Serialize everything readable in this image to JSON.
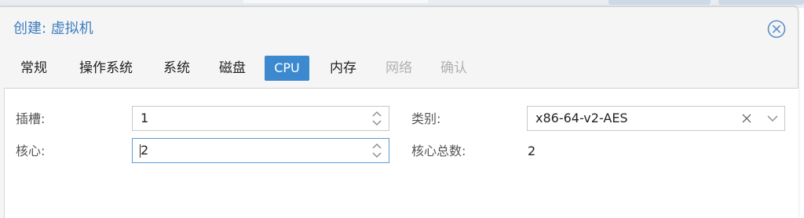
{
  "dialog": {
    "title": "创建: 虚拟机",
    "close_icon": "close-circle-icon"
  },
  "tabs": [
    {
      "label": "常规",
      "state": "normal"
    },
    {
      "label": "操作系统",
      "state": "normal"
    },
    {
      "label": "系统",
      "state": "normal"
    },
    {
      "label": "磁盘",
      "state": "normal"
    },
    {
      "label": "CPU",
      "state": "active"
    },
    {
      "label": "内存",
      "state": "normal"
    },
    {
      "label": "网络",
      "state": "disabled"
    },
    {
      "label": "确认",
      "state": "disabled"
    }
  ],
  "cpu": {
    "sockets_label": "插槽:",
    "sockets_value": "1",
    "cores_label": "核心:",
    "cores_value": "2",
    "type_label": "类别:",
    "type_value": "x86-64-v2-AES",
    "total_cores_label": "核心总数:",
    "total_cores_value": "2"
  },
  "colors": {
    "accent": "#3d89d0",
    "title": "#3d7ec0",
    "disabled": "#b0b0b0"
  }
}
